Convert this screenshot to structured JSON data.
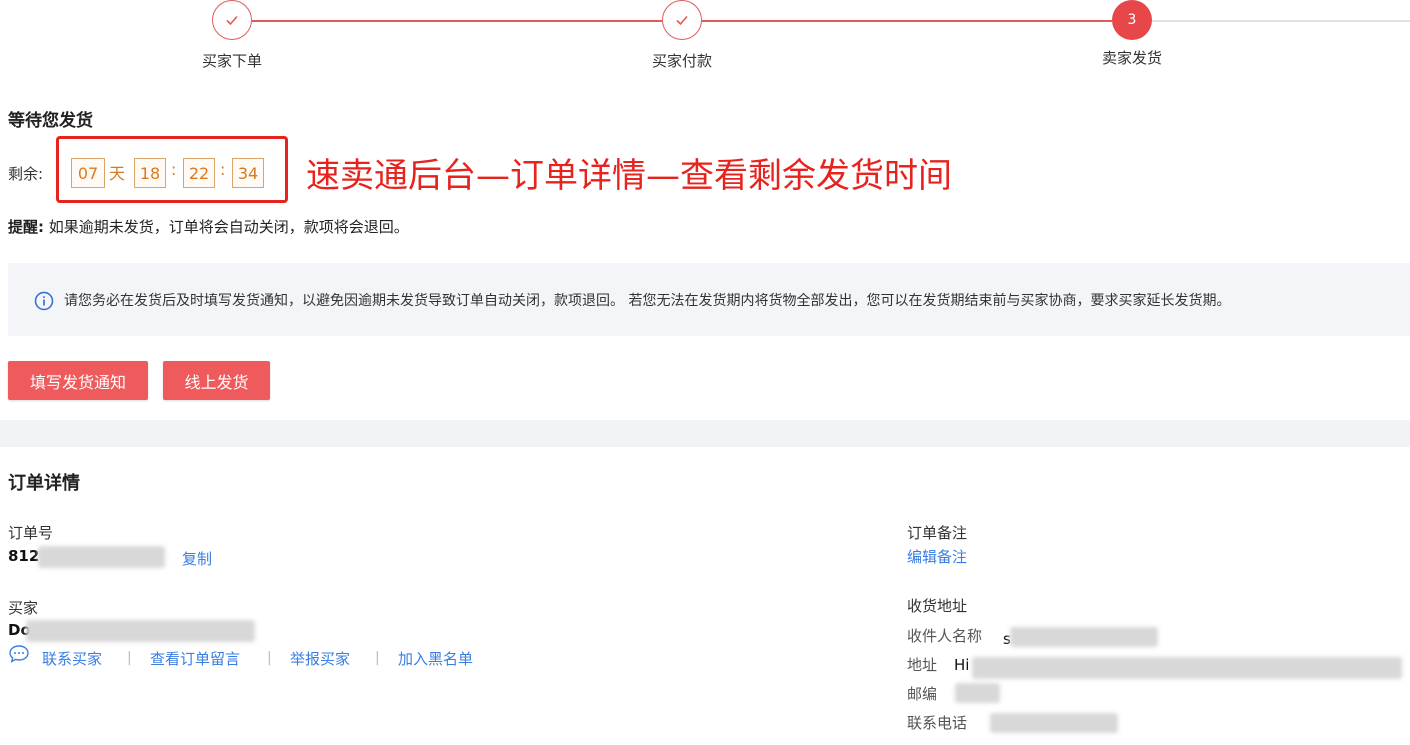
{
  "stepper": {
    "steps": [
      {
        "label": "买家下单",
        "state": "done"
      },
      {
        "label": "买家付款",
        "state": "done"
      },
      {
        "label": "卖家发货",
        "state": "active",
        "number": "3"
      }
    ]
  },
  "shipping": {
    "title": "等待您发货",
    "remaining_label": "剩余:",
    "countdown": {
      "days": "07",
      "day_unit": "天",
      "hours": "18",
      "minutes": "22",
      "seconds": "34",
      "separator": ":"
    },
    "reminder_label": "提醒:",
    "reminder_text": "如果逾期未发货，订单将会自动关闭，款项将会退回。",
    "notice_text": "请您务必在发货后及时填写发货通知，以避免因逾期未发货导致订单自动关闭，款项退回。 若您无法在发货期内将货物全部发出，您可以在发货期结束前与买家协商，要求买家延长发货期。",
    "buttons": {
      "fill_notice": "填写发货通知",
      "online_ship": "线上发货"
    }
  },
  "annotation": "速卖通后台—订单详情—查看剩余发货时间",
  "order": {
    "title": "订单详情",
    "order_no_label": "订单号",
    "order_no_value": "812",
    "copy_link": "复制",
    "buyer_label": "买家",
    "buyer_value": "Do",
    "actions": [
      "联系买家",
      "查看订单留言",
      "举报买家",
      "加入黑名单"
    ],
    "remark_label": "订单备注",
    "edit_remark": "编辑备注",
    "address_title": "收货地址",
    "recipient_label": "收件人名称",
    "recipient_value": "s",
    "address_label": "地址",
    "address_value": "Hi",
    "zip_label": "邮编",
    "phone_label": "联系电话"
  },
  "colors": {
    "accent": "#e8474a",
    "link": "#3a7ee0",
    "annotation": "#e8221d",
    "countdown": "#d77a22"
  }
}
